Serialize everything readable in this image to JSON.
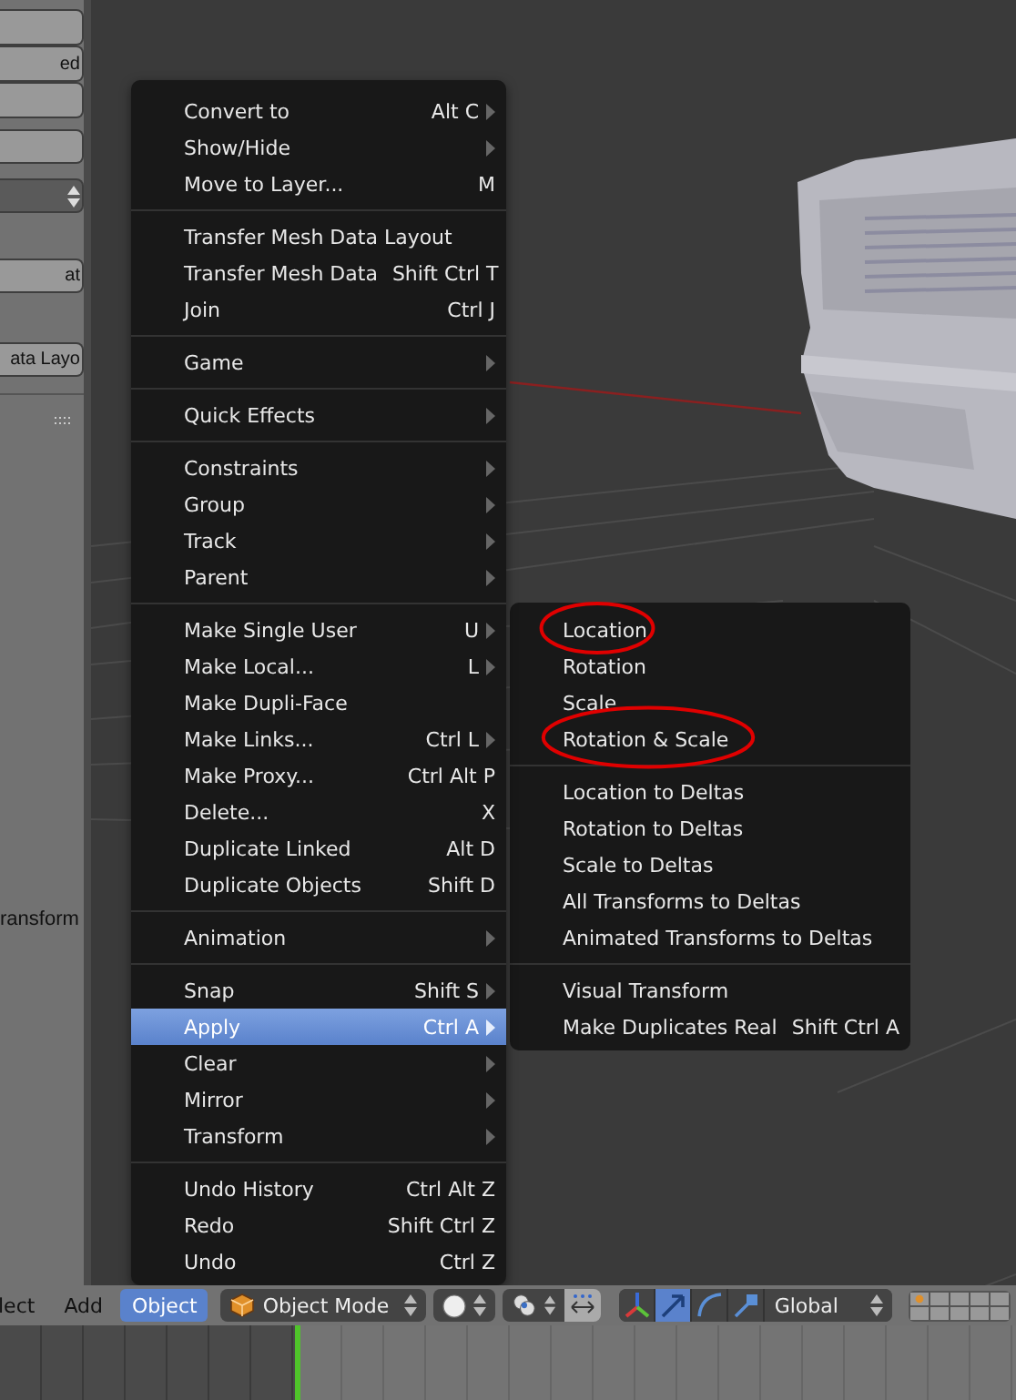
{
  "left_panel": {
    "groups": [
      {
        "items": [
          {
            "kind": "button"
          },
          {
            "kind": "button",
            "label": "ed"
          },
          {
            "kind": "button"
          }
        ]
      },
      {
        "items": [
          {
            "kind": "button"
          },
          {
            "kind": "dropdown"
          }
        ]
      },
      {
        "items": [
          {
            "kind": "button",
            "label": "at"
          }
        ]
      },
      {
        "items": [
          {
            "kind": "button",
            "label": "ata Layo"
          }
        ]
      }
    ],
    "section_label": "ransform"
  },
  "menu": {
    "sections": [
      {
        "items": [
          {
            "label": "Convert to",
            "shortcut": "Alt C",
            "submenu": true,
            "selected": false
          },
          {
            "label": "Show/Hide",
            "submenu": true,
            "selected": false
          },
          {
            "label": "Move to Layer...",
            "shortcut": "M",
            "submenu": false,
            "selected": false
          }
        ]
      },
      {
        "items": [
          {
            "label": "Transfer Mesh Data Layout",
            "submenu": false,
            "selected": false
          },
          {
            "label": "Transfer Mesh Data",
            "shortcut": "Shift Ctrl T",
            "submenu": false,
            "selected": false
          },
          {
            "label": "Join",
            "shortcut": "Ctrl J",
            "submenu": false,
            "selected": false
          }
        ]
      },
      {
        "items": [
          {
            "label": "Game",
            "submenu": true,
            "selected": false
          }
        ]
      },
      {
        "items": [
          {
            "label": "Quick Effects",
            "submenu": true,
            "selected": false
          }
        ]
      },
      {
        "items": [
          {
            "label": "Constraints",
            "submenu": true,
            "selected": false
          },
          {
            "label": "Group",
            "submenu": true,
            "selected": false
          },
          {
            "label": "Track",
            "submenu": true,
            "selected": false
          },
          {
            "label": "Parent",
            "submenu": true,
            "selected": false
          }
        ]
      },
      {
        "items": [
          {
            "label": "Make Single User",
            "shortcut": "U",
            "submenu": true,
            "selected": false
          },
          {
            "label": "Make Local...",
            "shortcut": "L",
            "submenu": true,
            "selected": false
          },
          {
            "label": "Make Dupli-Face",
            "submenu": false,
            "selected": false
          },
          {
            "label": "Make Links...",
            "shortcut": "Ctrl L",
            "submenu": true,
            "selected": false
          },
          {
            "label": "Make Proxy...",
            "shortcut": "Ctrl Alt P",
            "submenu": false,
            "selected": false
          },
          {
            "label": "Delete...",
            "shortcut": "X",
            "submenu": false,
            "selected": false
          },
          {
            "label": "Duplicate Linked",
            "shortcut": "Alt D",
            "submenu": false,
            "selected": false
          },
          {
            "label": "Duplicate Objects",
            "shortcut": "Shift D",
            "submenu": false,
            "selected": false
          }
        ]
      },
      {
        "items": [
          {
            "label": "Animation",
            "submenu": true,
            "selected": false
          }
        ]
      },
      {
        "items": [
          {
            "label": "Snap",
            "shortcut": "Shift S",
            "submenu": true,
            "selected": false
          },
          {
            "label": "Apply",
            "shortcut": "Ctrl A",
            "submenu": true,
            "selected": true
          },
          {
            "label": "Clear",
            "submenu": true,
            "selected": false
          },
          {
            "label": "Mirror",
            "submenu": true,
            "selected": false
          },
          {
            "label": "Transform",
            "submenu": true,
            "selected": false
          }
        ]
      },
      {
        "items": [
          {
            "label": "Undo History",
            "shortcut": "Ctrl Alt Z",
            "submenu": false,
            "selected": false
          },
          {
            "label": "Redo",
            "shortcut": "Shift Ctrl Z",
            "submenu": false,
            "selected": false
          },
          {
            "label": "Undo",
            "shortcut": "Ctrl Z",
            "submenu": false,
            "selected": false
          }
        ]
      }
    ]
  },
  "submenu": {
    "sections": [
      {
        "items": [
          {
            "label": "Location",
            "circled": true
          },
          {
            "label": "Rotation",
            "circled": false
          },
          {
            "label": "Scale",
            "circled": false
          },
          {
            "label": "Rotation & Scale",
            "circled": true
          }
        ]
      },
      {
        "items": [
          {
            "label": "Location to Deltas",
            "circled": false
          },
          {
            "label": "Rotation to Deltas",
            "circled": false
          },
          {
            "label": "Scale to Deltas",
            "circled": false
          },
          {
            "label": "All Transforms to Deltas",
            "circled": false
          },
          {
            "label": "Animated Transforms to Deltas",
            "circled": false
          }
        ]
      },
      {
        "items": [
          {
            "label": "Visual Transform",
            "circled": false
          },
          {
            "label": "Make Duplicates Real",
            "shortcut": "Shift Ctrl A",
            "circled": false
          }
        ]
      }
    ]
  },
  "header": {
    "menus": [
      {
        "label": "lect",
        "selected": false
      },
      {
        "label": "Add",
        "selected": false
      },
      {
        "label": "Object",
        "selected": true
      }
    ],
    "mode": "Object Mode",
    "manipulators": [
      {
        "kind": "axes",
        "selected": false
      },
      {
        "kind": "translate",
        "selected": true
      },
      {
        "kind": "rotate",
        "selected": false
      },
      {
        "kind": "scale",
        "selected": false
      }
    ],
    "orientation": "Global"
  }
}
